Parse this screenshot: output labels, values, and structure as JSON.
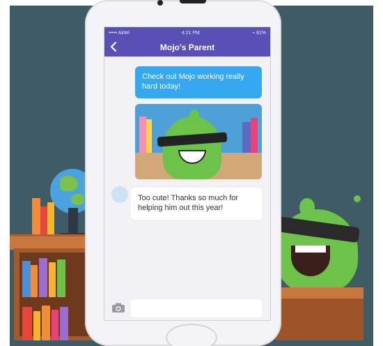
{
  "status_bar": {
    "carrier": "••••• Airtel",
    "time": "4:21 PM",
    "battery": "⌁ 81%"
  },
  "header": {
    "title": "Mojo's Parent",
    "back_icon": "chevron-left-icon"
  },
  "messages": [
    {
      "direction": "outgoing",
      "text": "Check out Mojo working really hard today!"
    },
    {
      "direction": "outgoing",
      "type": "image"
    },
    {
      "direction": "incoming",
      "text": "Too cute! Thanks so much for helping him out this year!"
    }
  ],
  "composer": {
    "camera_icon": "camera-icon",
    "placeholder": ""
  },
  "colors": {
    "nav": "#5a4fb5",
    "outgoing_bubble": "#35a8ef",
    "background": "#3f5c66"
  }
}
